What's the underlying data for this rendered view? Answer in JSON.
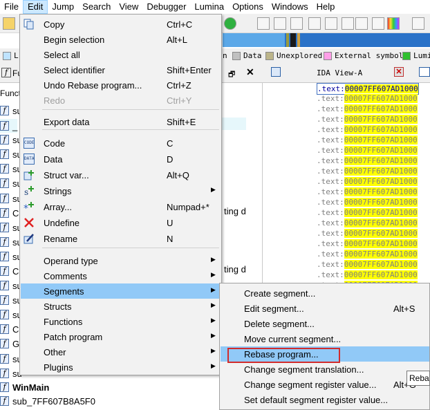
{
  "menubar": [
    "File",
    "Edit",
    "Jump",
    "Search",
    "View",
    "Debugger",
    "Lumina",
    "Options",
    "Windows",
    "Help"
  ],
  "legend": {
    "items": [
      {
        "label": "Data",
        "color": "#c0c0c0"
      },
      {
        "label": "Unexplored",
        "color": "#bcb58a"
      },
      {
        "label": "External symbol",
        "color": "#ff9ee8"
      },
      {
        "label": "Lumi",
        "color": "#30c030"
      }
    ],
    "stub_left": "L",
    "stub_mid": "n"
  },
  "func_panel": {
    "tab_title": "Fu",
    "header": "Functi",
    "rows": [
      "su",
      "_",
      "su",
      "su",
      "su",
      "su",
      "su",
      "C",
      "su",
      "su",
      "su",
      "C",
      "su",
      "su",
      "su",
      "C",
      "G",
      "su",
      "su",
      "WinMain",
      "sub_7FF607B8A5F0"
    ],
    "fragment_1": "ting d",
    "fragment_2": "ting d"
  },
  "ida_view": {
    "title": "IDA View-A",
    "segment": ".text:",
    "address": "00007FF607AD1000",
    "line_count": 20
  },
  "edit_menu": {
    "items": [
      {
        "label": "Copy",
        "shortcut": "Ctrl+C",
        "icon": "copy-icon"
      },
      {
        "label": "Begin selection",
        "shortcut": "Alt+L"
      },
      {
        "label": "Select all",
        "shortcut": ""
      },
      {
        "label": "Select identifier",
        "shortcut": "Shift+Enter"
      },
      {
        "label": "Undo Rebase program...",
        "shortcut": "Ctrl+Z"
      },
      {
        "label": "Redo",
        "shortcut": "Ctrl+Y",
        "disabled": true
      },
      {
        "label": "Export data",
        "shortcut": "Shift+E"
      },
      {
        "label": "Code",
        "shortcut": "C",
        "icon": "code-icon"
      },
      {
        "label": "Data",
        "shortcut": "D",
        "icon": "data-icon"
      },
      {
        "label": "Struct var...",
        "shortcut": "Alt+Q",
        "icon": "struct-var-icon"
      },
      {
        "label": "Strings",
        "shortcut": "",
        "icon": "strings-icon",
        "submenu": true
      },
      {
        "label": "Array...",
        "shortcut": "Numpad+*",
        "icon": "array-icon"
      },
      {
        "label": "Undefine",
        "shortcut": "U",
        "icon": "undefine-icon"
      },
      {
        "label": "Rename",
        "shortcut": "N",
        "icon": "rename-icon"
      },
      {
        "label": "Operand type",
        "submenu": true
      },
      {
        "label": "Comments",
        "submenu": true
      },
      {
        "label": "Segments",
        "submenu": true,
        "highlighted": true
      },
      {
        "label": "Structs",
        "submenu": true
      },
      {
        "label": "Functions",
        "submenu": true
      },
      {
        "label": "Patch program",
        "submenu": true
      },
      {
        "label": "Other",
        "submenu": true
      },
      {
        "label": "Plugins",
        "submenu": true
      }
    ]
  },
  "segments_menu": {
    "items": [
      {
        "label": "Create segment...",
        "shortcut": ""
      },
      {
        "label": "Edit segment...",
        "shortcut": "Alt+S"
      },
      {
        "label": "Delete segment...",
        "shortcut": ""
      },
      {
        "label": "Move current segment...",
        "shortcut": ""
      },
      {
        "label": "Rebase program...",
        "shortcut": "",
        "highlighted": true
      },
      {
        "label": "Change segment translation...",
        "shortcut": ""
      },
      {
        "label": "Change segment register value...",
        "shortcut": "Alt+G"
      },
      {
        "label": "Set default segment register value...",
        "shortcut": ""
      }
    ]
  },
  "tooltip": "Reba",
  "colors": {
    "menu_highlight": "#91c9f7",
    "address_highlight": "#ffff00",
    "rebase_outline": "#d22b2b",
    "nav_band": "#2a72c8"
  }
}
